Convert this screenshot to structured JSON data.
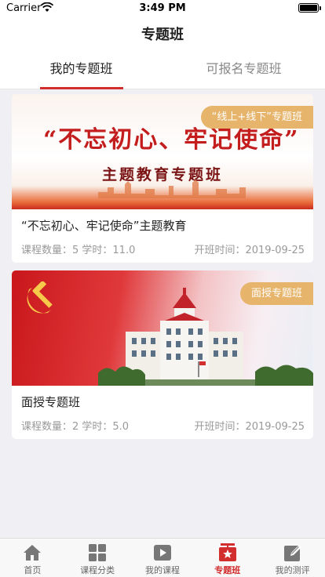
{
  "status_bar": {
    "carrier": "Carrier",
    "time": "3:49 PM"
  },
  "nav": {
    "title": "专题班"
  },
  "tabs": [
    {
      "label": "我的专题班",
      "active": true
    },
    {
      "label": "可报名专题班",
      "active": false
    }
  ],
  "courses": [
    {
      "badge": "“线上+线下”专题班",
      "banner_slogan": "“不忘初心、牢记使命”",
      "banner_subtitle": "主题教育专题班",
      "title": "“不忘初心、牢记使命”主题教育",
      "meta": "课程数量：5 学时：11.0",
      "date": "开班时间：2019-09-25"
    },
    {
      "badge": "面授专题班",
      "title": "面授专题班",
      "meta": "课程数量：2 学时：5.0",
      "date": "开班时间：2019-09-25"
    }
  ],
  "tabbar": [
    {
      "label": "首页",
      "icon": "home-icon"
    },
    {
      "label": "课程分类",
      "icon": "grid-icon"
    },
    {
      "label": "我的课程",
      "icon": "play-icon"
    },
    {
      "label": "专题班",
      "icon": "star-badge-icon",
      "active": true
    },
    {
      "label": "我的测评",
      "icon": "edit-note-icon"
    }
  ],
  "colors": {
    "accent": "#d32e2e",
    "badge": "#e6b46b"
  }
}
